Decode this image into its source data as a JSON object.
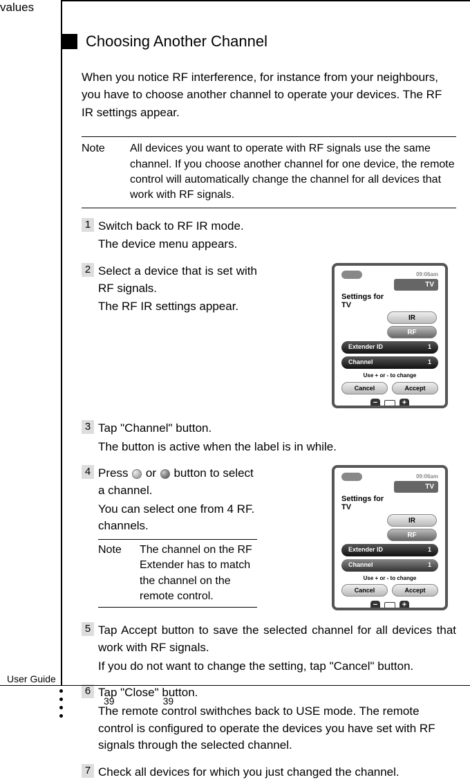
{
  "heading": "Choosing Another Channel",
  "intro": "When you notice RF interference, for instance from your neighbours, you have to choose another channel to operate your devices. The RF IR settings appear.",
  "note1": {
    "label": "Note",
    "text": "All devices you want to operate with RF signals use the same channel. If you choose another channel for one device, the remote control will automatically change the channel for all devices that work with RF signals."
  },
  "steps": {
    "s1": {
      "num": "1",
      "l1": "Switch back to RF IR mode.",
      "l2": "The device menu appears."
    },
    "s2": {
      "num": "2",
      "l1": "Select a device that is set with RF signals.",
      "l2": "The RF IR settings appear."
    },
    "s3": {
      "num": "3",
      "l1": "Tap  \"Channel\"  button.",
      "l2": "The button is active when the label is in while."
    },
    "s4": {
      "num": "4",
      "l1a": "Press ",
      "l1b": " or ",
      "l1c": "  button  to select a channel.",
      "l2": "You can select one from 4 RF. channels.",
      "note": {
        "label": "Note",
        "text": "The channel on the RF Extender has to match the channel on the remote control."
      }
    },
    "s5": {
      "num": "5",
      "l1": "Tap Accept button to save the selected channel for all devices that work with RF signals.",
      "l2": "If you do not want to change the setting, tap \"Cancel\" button."
    },
    "s6": {
      "num": "6",
      "l1": "Tap  \"Close\"  button.",
      "l2": "The remote control swithches back to USE mode. The remote control is configured to operate the devices you have set with RF signals through the selected channel."
    },
    "s7": {
      "num": "7",
      "l1": "Check all devices for which you just changed the channel."
    }
  },
  "device": {
    "time": "09:06am",
    "tv": "TV",
    "settings_for": "Settings for",
    "tv2": "TV",
    "ir": "IR",
    "rf": "RF",
    "extender_label": "Extender ID",
    "extender_val": "1",
    "channel_label": "Channel",
    "channel_val": "1",
    "hint": "Use + or - to change",
    "cancel": "Cancel",
    "accept": "Accept",
    "minus": "−",
    "plus": "+"
  },
  "footer": {
    "user_guide": "User Guide",
    "page1": "39",
    "page2": "39"
  }
}
